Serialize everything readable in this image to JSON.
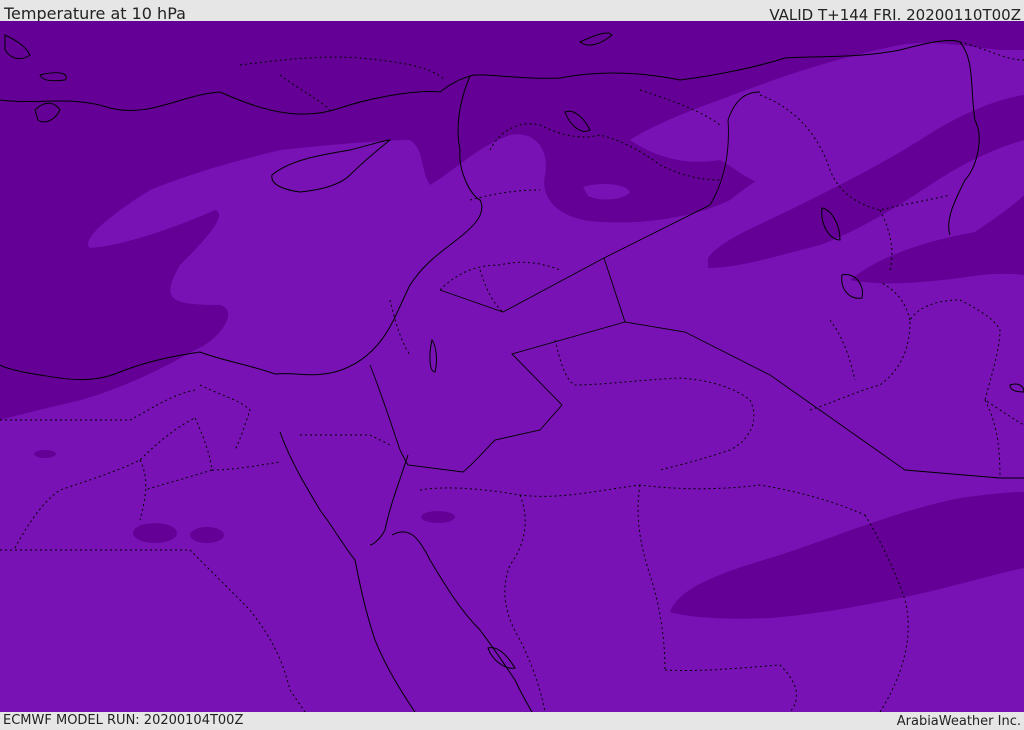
{
  "header": {
    "title": "Temperature at 10 hPa",
    "valid": "VALID T+144 FRI. 20200110T00Z"
  },
  "footer": {
    "model_run": "ECMWF MODEL RUN: 20200104T00Z",
    "credit": "ArabiaWeather Inc."
  },
  "colors": {
    "band_dark": "#640096",
    "band_light": "#7812b4",
    "coastline": "#000000",
    "frame_background": "#e6e6e6"
  }
}
